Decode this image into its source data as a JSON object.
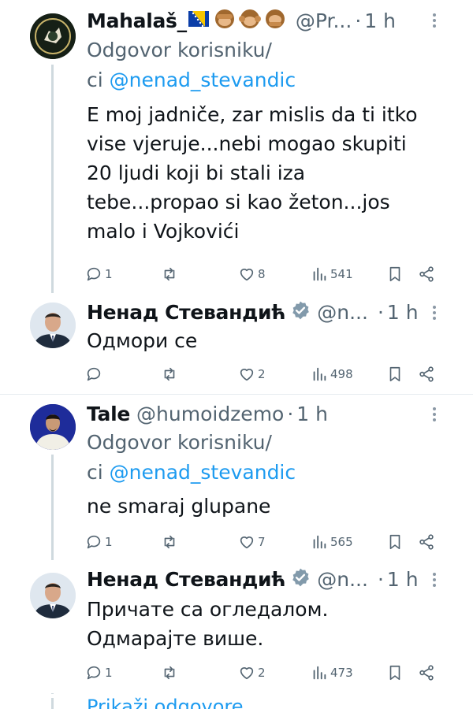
{
  "tweets": [
    {
      "name": "Mahalaš_",
      "handle": "@Pr...",
      "time": "1 h",
      "reply_prefix": "Odgovor korisniku/",
      "reply_line2_prefix": "ci ",
      "mention": "@nenad_stevandic",
      "text": "E moj jadniče, zar mislis da ti itko\nvise vjeruje...nebi mogao skupiti\n20 ljudi koji bi stali iza\ntebe...propao si kao žeton...jos\nmalo i Vojkovići",
      "replies": "1",
      "retweets": "",
      "likes": "8",
      "views": "541"
    },
    {
      "name": "Ненад Стевандић",
      "handle": "@n...",
      "time": "1 h",
      "text": "Одмори се",
      "replies": "",
      "retweets": "",
      "likes": "2",
      "views": "498"
    },
    {
      "name": "Tale",
      "handle": "@humoidzemo",
      "time": "1 h",
      "reply_prefix": "Odgovor korisniku/",
      "reply_line2_prefix": "ci ",
      "mention": "@nenad_stevandic",
      "text": "ne smaraj glupane",
      "replies": "1",
      "retweets": "",
      "likes": "7",
      "views": "565"
    },
    {
      "name": "Ненад Стевандић",
      "handle": "@n...",
      "time": "1 h",
      "text": "Причате са огледалом.\nОдмарајте више.",
      "replies": "1",
      "retweets": "",
      "likes": "2",
      "views": "473"
    }
  ],
  "show_replies": "Prikaži odgovore",
  "icons": [
    "reply-icon",
    "retweet-icon",
    "like-icon",
    "views-icon",
    "bookmark-icon",
    "share-icon",
    "verified-icon",
    "more-icon",
    "flag-icon",
    "monkey-emoji"
  ],
  "colors": {
    "accent": "#1d9bf0",
    "secondary": "#536471",
    "line": "#cfd9de",
    "verified": "#829aab"
  }
}
